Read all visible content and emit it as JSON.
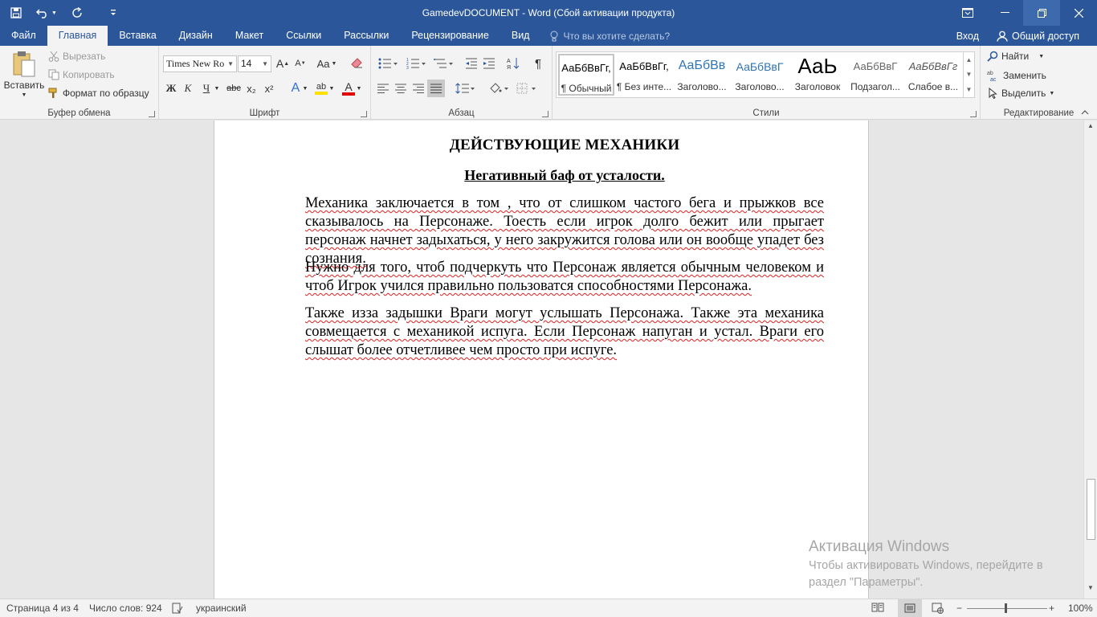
{
  "window": {
    "title": "GamedevDOCUMENT - Word (Сбой активации продукта)",
    "accent": "#2b579a"
  },
  "qat": {
    "save_icon": "save-icon",
    "undo_icon": "undo-icon",
    "redo_icon": "redo-icon",
    "customize_icon": "customize-icon"
  },
  "tabs": [
    {
      "label": "Файл"
    },
    {
      "label": "Главная"
    },
    {
      "label": "Вставка"
    },
    {
      "label": "Дизайн"
    },
    {
      "label": "Макет"
    },
    {
      "label": "Ссылки"
    },
    {
      "label": "Рассылки"
    },
    {
      "label": "Рецензирование"
    },
    {
      "label": "Вид"
    }
  ],
  "tell_me": {
    "placeholder": "Что вы хотите сделать?"
  },
  "account": {
    "login": "Вход",
    "share": "Общий доступ"
  },
  "clipboard": {
    "paste": "Вставить",
    "cut": "Вырезать",
    "copy": "Копировать",
    "format_painter": "Формат по образцу",
    "label": "Буфер обмена"
  },
  "font": {
    "name": "Times New Ro",
    "size": "14",
    "label": "Шрифт",
    "grow": "A",
    "shrink": "A",
    "case": "Aa",
    "bold": "Ж",
    "italic": "К",
    "underline": "Ч",
    "strike": "abc",
    "subscript": "x₂",
    "superscript": "x²",
    "effects": "A",
    "highlight": "ab",
    "color": "A"
  },
  "paragraph": {
    "label": "Абзац",
    "show_marks": "¶"
  },
  "styles": {
    "label": "Стили",
    "items": [
      {
        "sample": "АаБбВвГг,",
        "name": "¶ Обычный"
      },
      {
        "sample": "АаБбВвГг,",
        "name": "¶ Без инте..."
      },
      {
        "sample": "АаБбВв",
        "name": "Заголово..."
      },
      {
        "sample": "АаБбВвГ",
        "name": "Заголово..."
      },
      {
        "sample": "АаЬ",
        "name": "Заголовок"
      },
      {
        "sample": "АаБбВвГ",
        "name": "Подзагол..."
      },
      {
        "sample": "АаБбВвГг",
        "name": "Слабое в..."
      }
    ]
  },
  "editing": {
    "label": "Редактирование",
    "find": "Найти",
    "replace": "Заменить",
    "select": "Выделить"
  },
  "document": {
    "title": "ДЕЙСТВУЮЩИЕ МЕХАНИКИ",
    "subtitle": "Негативный баф от усталости.",
    "p1": "Механика заключается в том , что от слишком частого бега и прыжков все сказывалось на Персонаже. Тоесть если игрок долго бежит или прыгает персонаж начнет задыхаться, у него закружится голова или он вообще упадет без сознания.",
    "p2": " Нужно для того, чтоб подчеркуть что Персонаж является обычным человеком и чтоб Игрок учился правильно пользоватся способностями Персонажа.",
    "p3": "Также изза задышки Враги могут услышать Персонажа. Также эта механика совмещается с механикой испуга. Если Персонаж напуган и устал. Враги его слышат более отчетливее чем просто при испуге."
  },
  "watermark": {
    "title": "Активация Windows",
    "line1": "Чтобы активировать Windows, перейдите в",
    "line2": "раздел \"Параметры\"."
  },
  "status": {
    "page": "Страница 4 из 4",
    "words": "Число слов: 924",
    "language": "украинский",
    "zoom": "100%",
    "zoom_minus": "−",
    "zoom_plus": "+"
  }
}
